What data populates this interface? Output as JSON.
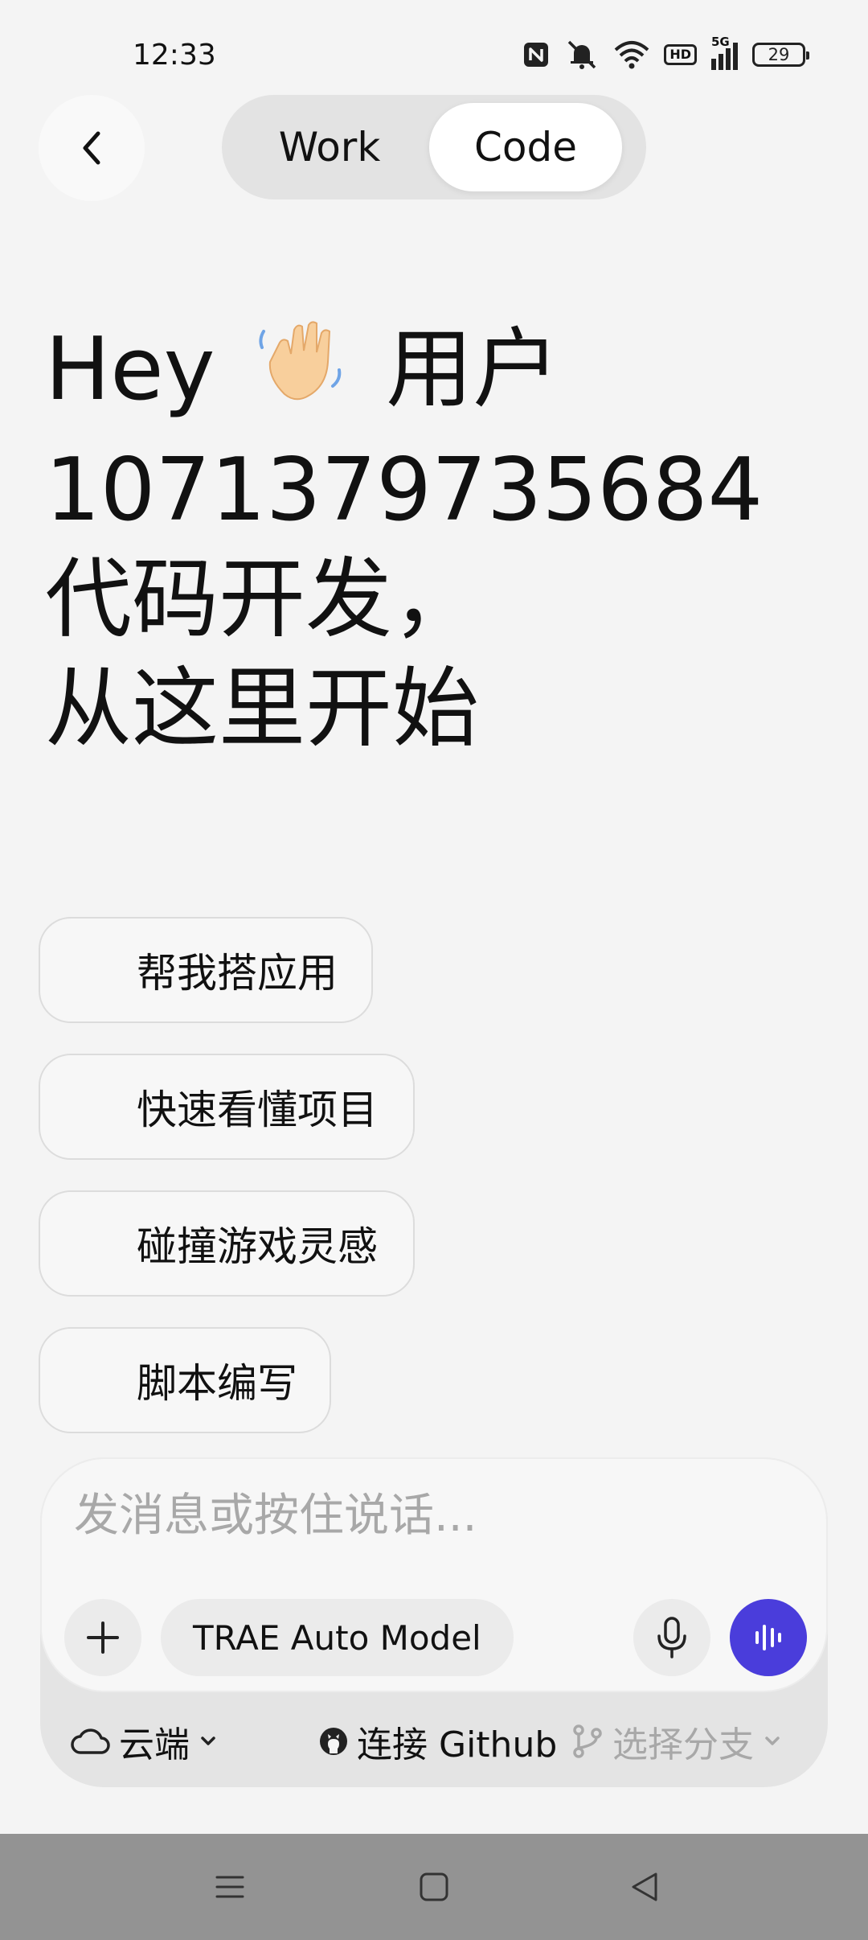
{
  "status_bar": {
    "time": "12:33",
    "battery": "29",
    "hd_label": "HD",
    "network_label": "5G",
    "icons": [
      "nfc-icon",
      "mute-icon",
      "wifi-icon",
      "hd-icon",
      "signal-icon",
      "battery-icon"
    ]
  },
  "header": {
    "back_icon": "chevron-left-icon",
    "tabs": [
      {
        "label": "Work",
        "selected": false
      },
      {
        "label": "Code",
        "selected": true
      }
    ]
  },
  "greeting": {
    "line1_prefix": "Hey",
    "line1_emoji": "waving-hand-emoji",
    "line1_suffix": "用户",
    "line2": "1071379735684",
    "line3": "代码开发，",
    "line4": "从这里开始"
  },
  "suggestions": [
    {
      "label": "帮我搭应用"
    },
    {
      "label": "快速看懂项目"
    },
    {
      "label": "碰撞游戏灵感"
    },
    {
      "label": "脚本编写"
    }
  ],
  "composer": {
    "placeholder": "发消息或按住说话...",
    "value": "",
    "model_label": "TRAE Auto Model",
    "accent_color": "#4a3ddb"
  },
  "composer_footer": {
    "environment_label": "云端",
    "github_label": "连接 Github",
    "branch_label": "选择分支"
  },
  "nav_bar": {
    "icons": [
      "menu-icon",
      "home-icon",
      "back-triangle-icon"
    ]
  }
}
